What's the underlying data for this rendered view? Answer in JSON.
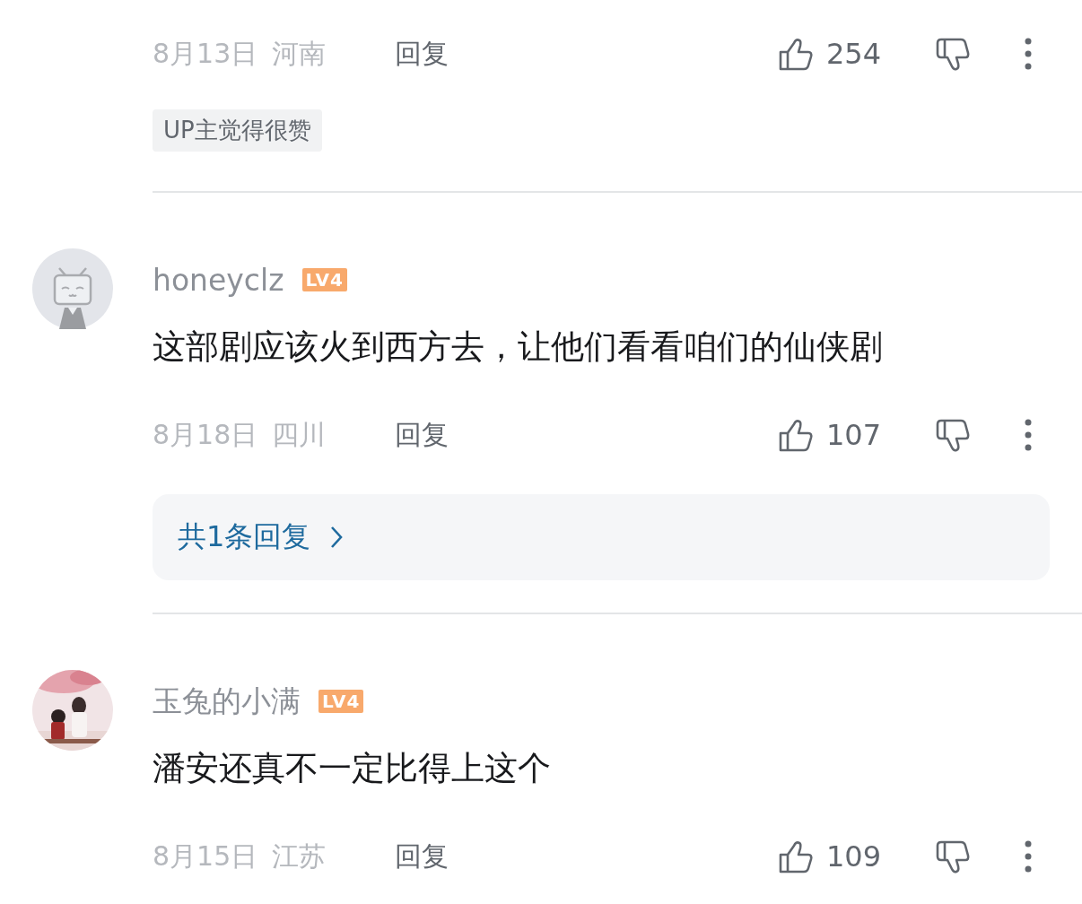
{
  "comments": [
    {
      "date": "8月13日",
      "region": "河南",
      "reply_label": "回复",
      "likes": "254",
      "tag": "UP主觉得很赞"
    },
    {
      "avatar": {
        "kind": "default"
      },
      "name": "honeyclz",
      "level_badge": "LV4",
      "text": "这部剧应该火到西方去，让他们看看咱们的仙侠剧",
      "date": "8月18日",
      "region": "四川",
      "reply_label": "回复",
      "likes": "107",
      "replies": "共1条回复"
    },
    {
      "name": "玉兔的小满",
      "level_badge": "LV4",
      "text": "潘安还真不一定比得上这个",
      "date": "8月15日",
      "region": "江苏",
      "reply_label": "回复",
      "likes": "109"
    }
  ]
}
